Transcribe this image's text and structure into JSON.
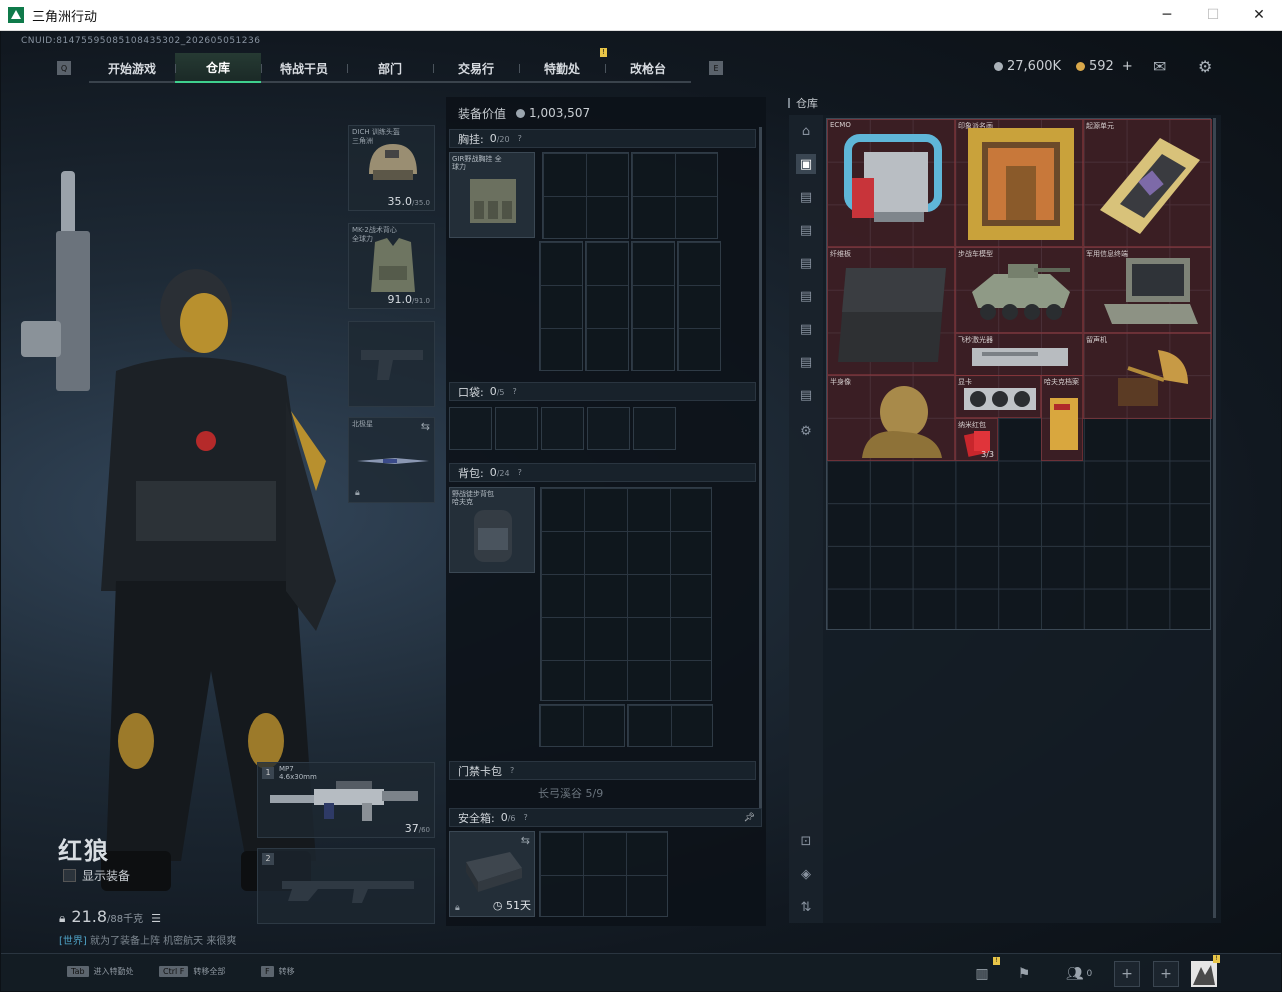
{
  "window": {
    "title": "三角洲行动",
    "minimize": "─",
    "maximize": "☐",
    "close": "✕"
  },
  "uid": "CNUID:8147559508510843530​2_202605051236",
  "nav": {
    "tabs": [
      "开始游戏",
      "仓库",
      "特战干员",
      "部门",
      "交易行",
      "特勤处",
      "改枪台"
    ],
    "active_index": 1,
    "badge": "!"
  },
  "currency": {
    "silver": "27,600K",
    "gold": "592",
    "add": "+"
  },
  "character": {
    "name": "红狼",
    "show_equipment": "显示装备",
    "weight_value": "21.8",
    "weight_max": "/88千克",
    "chat_world": "[世界]",
    "chat_text": "就为了装备上阵  机密航天 来很爽"
  },
  "gear": {
    "helmet": {
      "label": "DICH 训练头盔 三角洲",
      "value": "35.0",
      "max": "/35.0"
    },
    "armor": {
      "label": "MK-2战术背心 全球力",
      "value": "91.0",
      "max": "/91.0"
    },
    "melee": {
      "label": "北极星"
    },
    "primary": {
      "num": "1",
      "label": "MP7",
      "sub": "4.6x30mm",
      "ammo": "37",
      "ammo_max": "/60"
    },
    "secondary": {
      "num": "2"
    }
  },
  "loadout": {
    "value_label": "装备价值",
    "value": "1,003,507",
    "chest": {
      "title": "胸挂:",
      "count": "0",
      "max": "/20",
      "item_label": "GIR野战胸挂 全球力"
    },
    "pocket": {
      "title": "口袋:",
      "count": "0",
      "max": "/5"
    },
    "backpack": {
      "title": "背包:",
      "count": "0",
      "max": "/24",
      "item_label": "野战徒步背包 哈夫克"
    },
    "keycard": {
      "title": "门禁卡包",
      "sub": "长弓溪谷 5/9"
    },
    "safebox": {
      "title": "安全箱:",
      "count": "0",
      "max": "/6",
      "timer": "51天"
    }
  },
  "stash": {
    "label": "仓库",
    "items": [
      {
        "label": "ECMO"
      },
      {
        "label": "印象派名画"
      },
      {
        "label": "起源单元"
      },
      {
        "label": "纤维板"
      },
      {
        "label": "步战车模型"
      },
      {
        "label": "军用信息终端"
      },
      {
        "label": "飞秒激光器"
      },
      {
        "label": "留声机"
      },
      {
        "label": "半身像"
      },
      {
        "label": "显卡"
      },
      {
        "label": "哈夫克档案"
      },
      {
        "label": "纳米红包",
        "qty": "3/3"
      }
    ]
  },
  "bottom": {
    "hints": [
      {
        "key": "Tab",
        "text": "进入特勤处"
      },
      {
        "key": "Ctrl F",
        "text": "转移全部"
      },
      {
        "key": "F",
        "text": "转移"
      }
    ],
    "friends_count": "0"
  }
}
